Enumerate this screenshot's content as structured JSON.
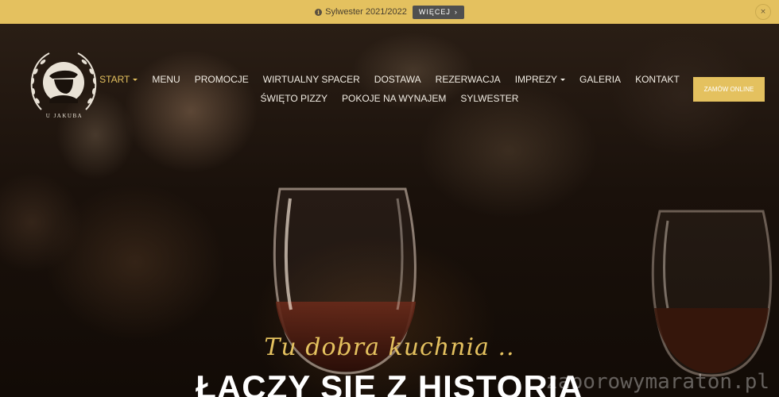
{
  "announcement": {
    "icon": "info-icon",
    "text": "Sylwester 2021/2022",
    "more_label": "WIĘCEJ",
    "close_label": "×",
    "background_color": "#e4c15f"
  },
  "logo": {
    "icon": "logo-emblem-icon",
    "text": "U JAKUBA"
  },
  "nav": {
    "row1": [
      {
        "label": "START",
        "active": true,
        "dropdown": true
      },
      {
        "label": "MENU"
      },
      {
        "label": "PROMOCJE"
      },
      {
        "label": "WIRTUALNY SPACER"
      },
      {
        "label": "DOSTAWA"
      },
      {
        "label": "REZERWACJA"
      },
      {
        "label": "IMPREZY",
        "dropdown": true
      },
      {
        "label": "GALERIA"
      },
      {
        "label": "KONTAKT"
      }
    ],
    "row2": [
      {
        "label": "ŚWIĘTO PIZZY"
      },
      {
        "label": "POKOJE NA WYNAJEM"
      },
      {
        "label": "SYLWESTER"
      }
    ]
  },
  "order_button": {
    "label": "ZAMÓW ONLINE"
  },
  "hero": {
    "tagline": "Tu dobra kuchnia ..",
    "headline": "ŁĄCZY SIĘ Z HISTORIĄ",
    "watermark": "zaporowymaraton.pl"
  },
  "colors": {
    "accent": "#e4c15f",
    "nav_text": "#f2ede4",
    "background": "#140d08"
  }
}
